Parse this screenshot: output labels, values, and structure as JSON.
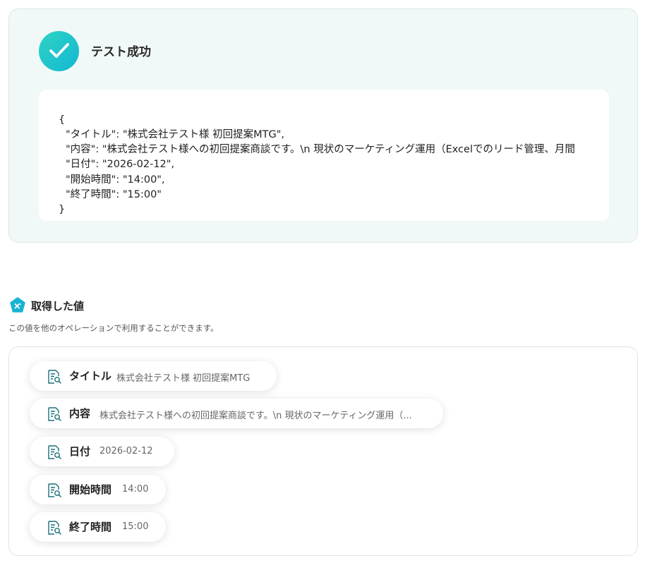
{
  "test_result": {
    "title": "テスト成功",
    "json_lines": [
      "{",
      "\"タイトル\": \"株式会社テスト様 初回提案MTG\",",
      "\"内容\": \"株式会社テスト様への初回提案商談です。\\n 現状のマーケティング運用（Excelでのリード管理、月間",
      "\"日付\": \"2026-02-12\",",
      "\"開始時間\": \"14:00\",",
      "\"終了時間\": \"15:00\"",
      "}"
    ]
  },
  "acquired": {
    "title": "取得した値",
    "description": "この値を他のオペレーションで利用することができます。",
    "items": [
      {
        "label": "タイトル",
        "value": "株式会社テスト様 初回提案MTG"
      },
      {
        "label": "内容",
        "value": "株式会社テスト様への初回提案商談です。\\n 現状のマーケティング運用（..."
      },
      {
        "label": "日付",
        "value": "2026-02-12"
      },
      {
        "label": "開始時間",
        "value": "14:00"
      },
      {
        "label": "終了時間",
        "value": "15:00"
      }
    ]
  },
  "colors": {
    "accent": "#19c3c9",
    "panel_bg": "#f1f9f8",
    "icon_teal": "#1a6f7a"
  },
  "icons": {
    "success": "check-icon",
    "section": "variable-badge-icon",
    "item": "document-search-icon"
  }
}
